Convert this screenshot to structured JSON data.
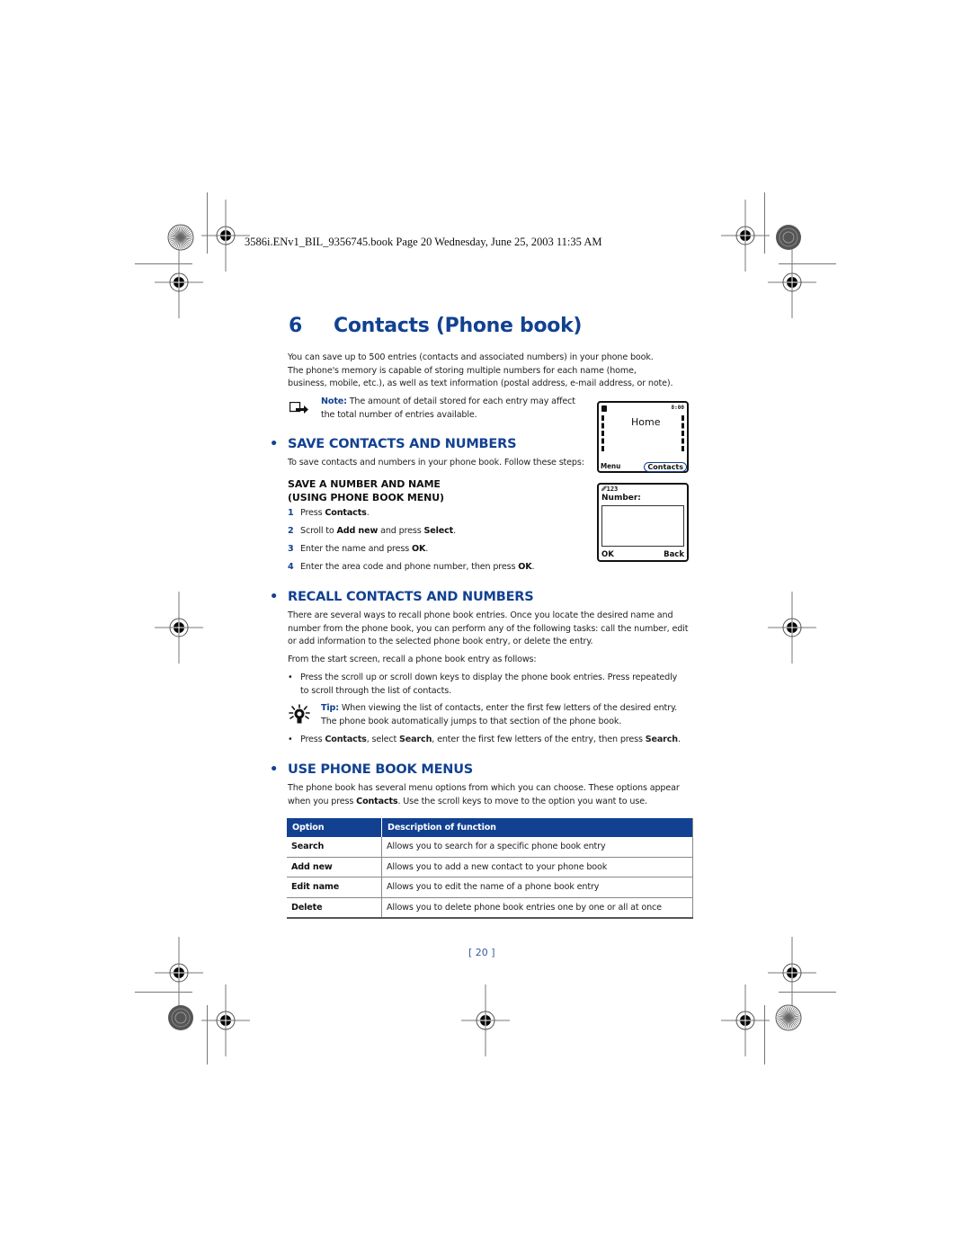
{
  "header": {
    "file_line": "3586i.ENv1_BIL_9356745.book  Page 20  Wednesday, June 25, 2003  11:35 AM"
  },
  "chapter": {
    "number": "6",
    "title": "Contacts (Phone book)"
  },
  "intro": {
    "line1": "You can save up to 500 entries (contacts and associated numbers) in your phone book.",
    "line2": "The phone's memory is capable of storing multiple numbers for each name (home,",
    "line3": "business, mobile, etc.), as well as text information (postal address, e-mail address, or note)."
  },
  "note": {
    "icon": "note-icon",
    "label": "Note:",
    "line1": " The amount of detail stored for each entry may affect",
    "line2": "the total number of entries available."
  },
  "phone_screen_home": {
    "time": "8:00",
    "title": "Home",
    "left_softkey": "Menu",
    "right_softkey": "Contacts"
  },
  "phone_screen_number": {
    "status": "123",
    "label": "Number:",
    "left_softkey": "OK",
    "right_softkey": "Back"
  },
  "save_section": {
    "bullet": "•",
    "heading": "SAVE CONTACTS AND NUMBERS",
    "intro": "To save contacts and numbers in your phone book. Follow these steps:",
    "subheading_line1": "SAVE A NUMBER AND NAME",
    "subheading_line2": "(USING PHONE BOOK MENU)",
    "steps": [
      {
        "n": "1",
        "pre": "Press ",
        "b1": "Contacts",
        "mid": ".",
        "b2": "",
        "post": ""
      },
      {
        "n": "2",
        "pre": "Scroll to ",
        "b1": "Add new",
        "mid": " and press ",
        "b2": "Select",
        "post": "."
      },
      {
        "n": "3",
        "pre": "Enter the name and press ",
        "b1": "OK",
        "mid": ".",
        "b2": "",
        "post": ""
      },
      {
        "n": "4",
        "pre": "Enter the area code and phone number, then press ",
        "b1": "OK",
        "mid": ".",
        "b2": "",
        "post": ""
      }
    ]
  },
  "recall_section": {
    "bullet": "•",
    "heading": "RECALL CONTACTS AND NUMBERS",
    "para_line1": "There are several ways to recall phone book entries. Once you locate the desired name and",
    "para_line2": "number from the phone book, you can perform any of the following tasks: call the number, edit",
    "para_line3": "or add information to the selected phone book entry, or delete the entry.",
    "from_start": "From the start screen, recall a phone book entry as follows:",
    "bullet1_line1": "Press the scroll up or scroll down keys to display the phone book entries. Press repeatedly",
    "bullet1_line2": "to scroll through the list of contacts.",
    "tip": {
      "icon": "lightbulb-icon",
      "label": "Tip:",
      "line1": " When viewing the list of contacts, enter the first few letters of the desired entry.",
      "line2": "The phone book automatically jumps to that section of the phone book."
    },
    "bullet2": {
      "pre": "Press ",
      "b1": "Contacts",
      "mid1": ", select ",
      "b2": "Search",
      "mid2": ", enter the first few letters of the entry, then press ",
      "b3": "Search",
      "post": "."
    }
  },
  "menus_section": {
    "bullet": "•",
    "heading": "USE PHONE BOOK MENUS",
    "line1": "The phone book has several menu options from which you can choose. These options appear",
    "line2_pre": "when you press ",
    "line2_b": "Contacts",
    "line2_post": ". Use the scroll keys to move to the option you want to use."
  },
  "table": {
    "headers": [
      "Option",
      "Description of function"
    ],
    "rows": [
      [
        "Search",
        "Allows you to search for a specific phone book entry"
      ],
      [
        "Add new",
        "Allows you to add a new contact to your phone book"
      ],
      [
        "Edit name",
        "Allows you to edit the name of a phone book entry"
      ],
      [
        "Delete",
        "Allows you to delete phone book entries one by one or all at once"
      ]
    ]
  },
  "footer": {
    "page_number": "[ 20 ]"
  }
}
